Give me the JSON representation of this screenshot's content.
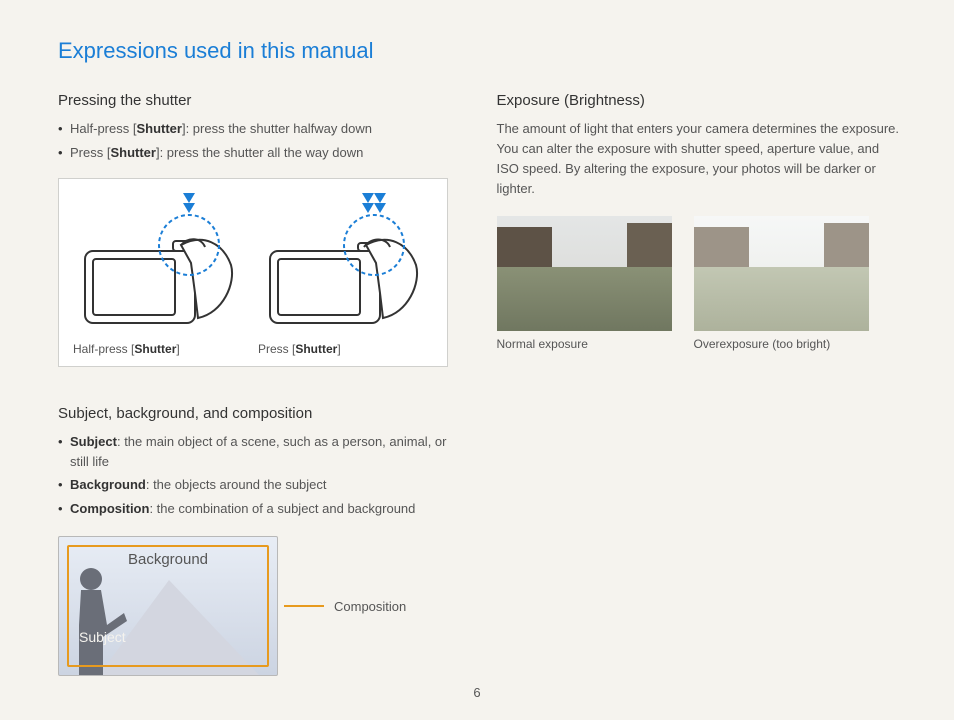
{
  "title": "Expressions used in this manual",
  "pageNumber": "6",
  "left": {
    "shutter": {
      "heading": "Pressing the shutter",
      "items": [
        {
          "prefix": "Half-press [",
          "bold": "Shutter",
          "suffix": "]: press the shutter halfway down"
        },
        {
          "prefix": "Press [",
          "bold": "Shutter",
          "suffix": "]: press the shutter all the way down"
        }
      ],
      "captions": [
        {
          "prefix": "Half-press [",
          "bold": "Shutter",
          "suffix": "]"
        },
        {
          "prefix": "Press [",
          "bold": "Shutter",
          "suffix": "]"
        }
      ]
    },
    "subject": {
      "heading": "Subject, background, and composition",
      "items": [
        {
          "bold": "Subject",
          "rest": ": the main object of a scene, such as a person, animal, or still life"
        },
        {
          "bold": "Background",
          "rest": ": the objects around the subject"
        },
        {
          "bold": "Composition",
          "rest": ": the combination of a subject and background"
        }
      ],
      "labels": {
        "background": "Background",
        "subject": "Subject",
        "composition": "Composition"
      }
    }
  },
  "right": {
    "exposure": {
      "heading": "Exposure (Brightness)",
      "paragraph": "The amount of light that enters your camera determines the exposure. You can alter the exposure with shutter speed, aperture value, and ISO speed. By altering the exposure, your photos will be darker or lighter.",
      "captions": {
        "normal": "Normal exposure",
        "over": "Overexposure (too bright)"
      }
    }
  }
}
